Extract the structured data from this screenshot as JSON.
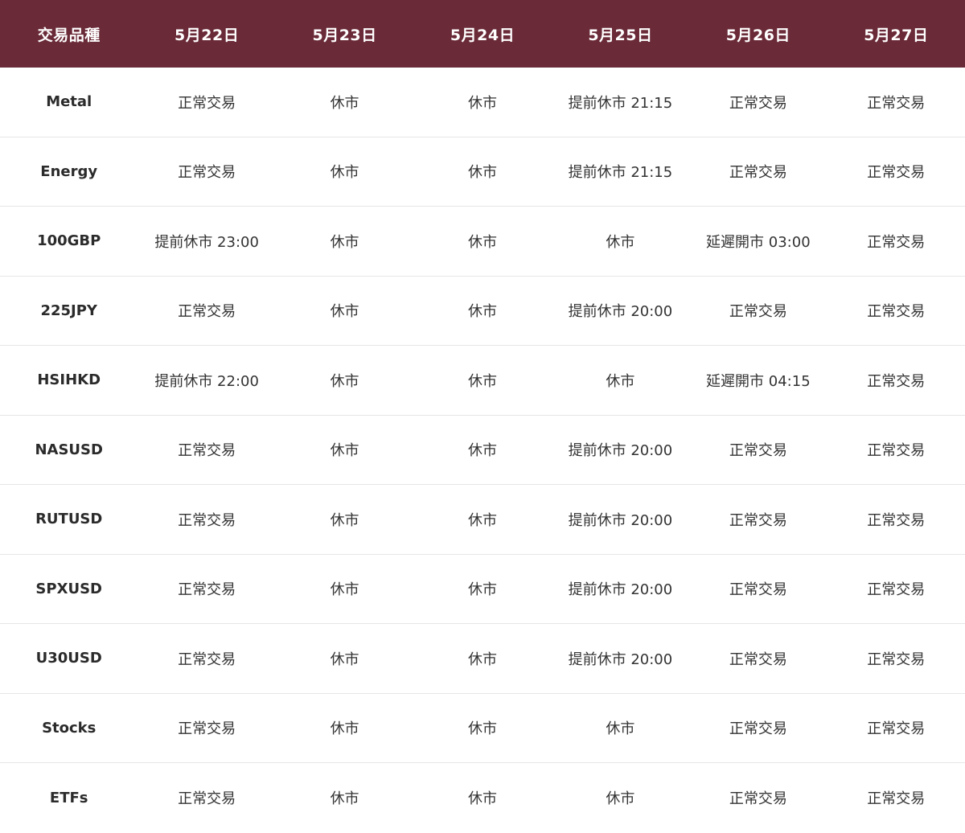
{
  "table": {
    "headers": [
      "交易品種",
      "5月22日",
      "5月23日",
      "5月24日",
      "5月25日",
      "5月26日",
      "5月27日"
    ],
    "rows": [
      [
        "Metal",
        "正常交易",
        "休市",
        "休市",
        "提前休市 21:15",
        "正常交易",
        "正常交易"
      ],
      [
        "Energy",
        "正常交易",
        "休市",
        "休市",
        "提前休市 21:15",
        "正常交易",
        "正常交易"
      ],
      [
        "100GBP",
        "提前休市 23:00",
        "休市",
        "休市",
        "休市",
        "延遲開市 03:00",
        "正常交易"
      ],
      [
        "225JPY",
        "正常交易",
        "休市",
        "休市",
        "提前休市 20:00",
        "正常交易",
        "正常交易"
      ],
      [
        "HSIHKD",
        "提前休市 22:00",
        "休市",
        "休市",
        "休市",
        "延遲開市 04:15",
        "正常交易"
      ],
      [
        "NASUSD",
        "正常交易",
        "休市",
        "休市",
        "提前休市 20:00",
        "正常交易",
        "正常交易"
      ],
      [
        "RUTUSD",
        "正常交易",
        "休市",
        "休市",
        "提前休市 20:00",
        "正常交易",
        "正常交易"
      ],
      [
        "SPXUSD",
        "正常交易",
        "休市",
        "休市",
        "提前休市 20:00",
        "正常交易",
        "正常交易"
      ],
      [
        "U30USD",
        "正常交易",
        "休市",
        "休市",
        "提前休市 20:00",
        "正常交易",
        "正常交易"
      ],
      [
        "Stocks",
        "正常交易",
        "休市",
        "休市",
        "休市",
        "正常交易",
        "正常交易"
      ],
      [
        "ETFs",
        "正常交易",
        "休市",
        "休市",
        "休市",
        "正常交易",
        "正常交易"
      ]
    ]
  },
  "colors": {
    "header_bg": "#6a2a37",
    "header_text": "#ffffff",
    "row_divider": "#e6e6e6",
    "cell_text": "#333333"
  }
}
